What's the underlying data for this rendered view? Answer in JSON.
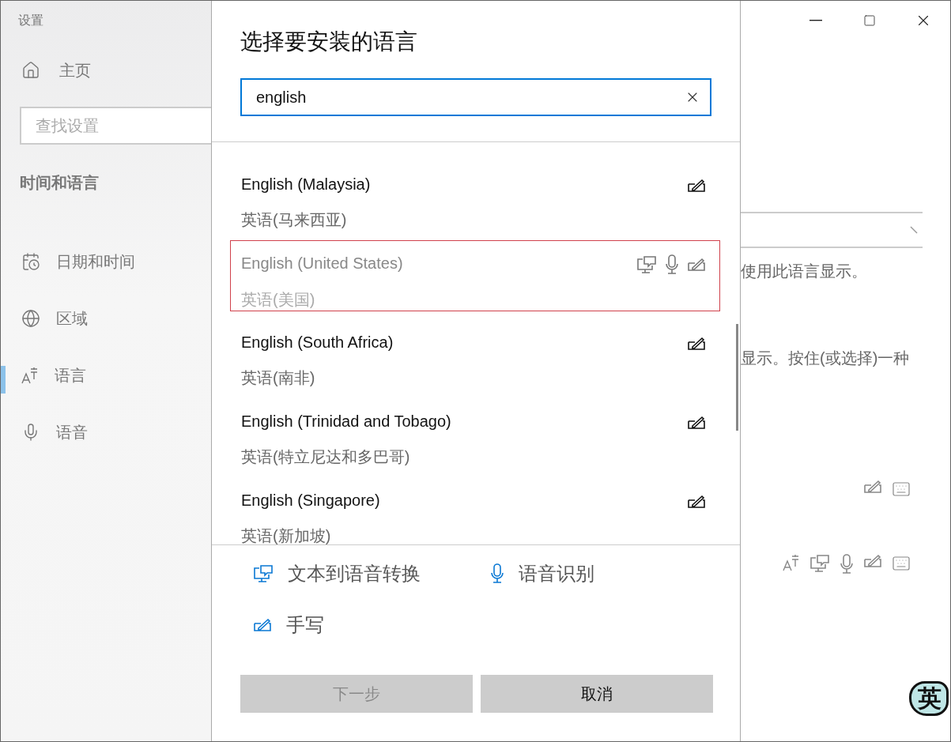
{
  "window": {
    "title": "设置"
  },
  "sidebar": {
    "home": "主页",
    "search": {
      "placeholder": "查找设置"
    },
    "section": "时间和语言",
    "items": [
      {
        "kind": "datetime",
        "label": "日期和时间",
        "selected": false
      },
      {
        "kind": "region",
        "label": "区域",
        "selected": false
      },
      {
        "kind": "language",
        "label": "语言",
        "selected": true
      },
      {
        "kind": "speech",
        "label": "语音",
        "selected": false
      }
    ]
  },
  "dialog": {
    "title": "选择要安装的语言",
    "search": {
      "value": "english"
    },
    "list": {
      "items": [
        {
          "name": "English (Malaysia)",
          "native": "英语(马来西亚)",
          "features": [
            {
              "kind": "handwriting"
            }
          ],
          "selected": false,
          "disabled": false
        },
        {
          "name": "English (United States)",
          "native": "英语(美国)",
          "features": [
            {
              "kind": "tts"
            },
            {
              "kind": "speech"
            },
            {
              "kind": "handwriting"
            }
          ],
          "selected": true,
          "disabled": true
        },
        {
          "name": "English (South Africa)",
          "native": "英语(南非)",
          "features": [
            {
              "kind": "handwriting"
            }
          ],
          "selected": false,
          "disabled": false
        },
        {
          "name": "English (Trinidad and Tobago)",
          "native": "英语(特立尼达和多巴哥)",
          "features": [
            {
              "kind": "handwriting"
            }
          ],
          "selected": false,
          "disabled": false
        },
        {
          "name": "English (Singapore)",
          "native": "英语(新加坡)",
          "features": [
            {
              "kind": "handwriting"
            }
          ],
          "selected": false,
          "disabled": false
        }
      ]
    },
    "legend": [
      {
        "kind": "tts",
        "label": "文本到语音转换"
      },
      {
        "kind": "speech",
        "label": "语音识别"
      },
      {
        "kind": "handwriting",
        "label": "手写"
      }
    ],
    "buttons": [
      {
        "label": "下一步",
        "disabled": true
      },
      {
        "label": "取消",
        "disabled": false
      }
    ]
  },
  "background": {
    "texts": [
      "使用此语言显示。",
      "显示。按住(或选择)一种"
    ]
  },
  "ime_badge": "英"
}
